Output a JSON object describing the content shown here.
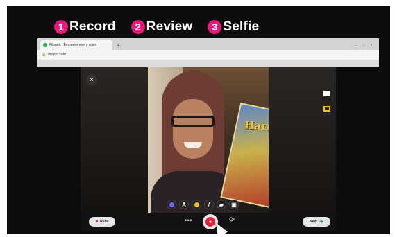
{
  "steps": [
    {
      "num": "1",
      "label": "Record"
    },
    {
      "num": "2",
      "label": "Review"
    },
    {
      "num": "3",
      "label": "Selfie"
    }
  ],
  "browser": {
    "tab_title": "Flipgrid | Empower every voice",
    "new_tab": "+",
    "window_controls": "– □ ×",
    "url": "flipgrid.com"
  },
  "recorder": {
    "close": "×",
    "book_title": "Harry",
    "tools": [
      {
        "name": "tool-color",
        "label": "",
        "color": "#7b61ff"
      },
      {
        "name": "tool-text",
        "label": "A",
        "color": ""
      },
      {
        "name": "tool-emoji",
        "label": "",
        "color": "#f2c21b"
      },
      {
        "name": "tool-pen",
        "label": "/",
        "color": ""
      },
      {
        "name": "tool-sticker",
        "label": "▰",
        "color": ""
      },
      {
        "name": "tool-board",
        "label": "▣",
        "color": ""
      }
    ],
    "redo_label": "Redo",
    "more_label": "•••",
    "flip_label": "⟳",
    "next_label": "Next",
    "next_arrow": "➜"
  },
  "colors": {
    "accent": "#e8197a",
    "record": "#e6253d",
    "next_arrow": "#1fa64a"
  }
}
